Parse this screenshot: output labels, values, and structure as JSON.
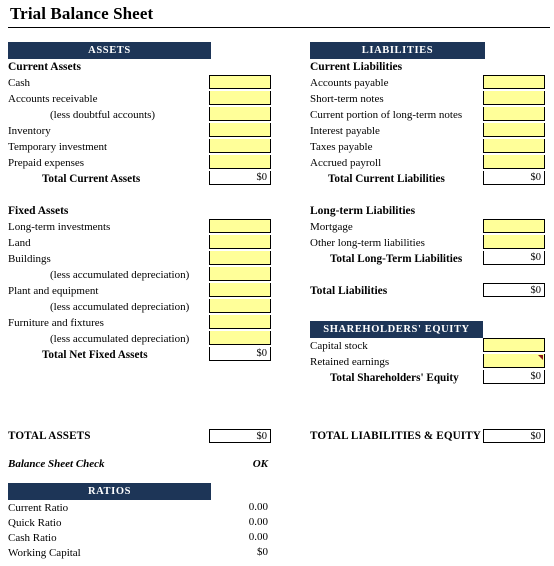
{
  "document": {
    "title": "Trial Balance Sheet"
  },
  "colors": {
    "header_bar": "#1d3557",
    "input_cell": "#ffff99",
    "output_cell": "#ffffff",
    "comment_marker": "#8b1a1a",
    "text": "#000000"
  },
  "assets": {
    "section_header": "ASSETS",
    "current": {
      "group_label": "Current Assets",
      "items": [
        {
          "label": "Cash",
          "value": ""
        },
        {
          "label": "Accounts receivable",
          "value": ""
        },
        {
          "label": "(less doubtful accounts)",
          "value": ""
        },
        {
          "label": "Inventory",
          "value": ""
        },
        {
          "label": "Temporary investment",
          "value": ""
        },
        {
          "label": "Prepaid expenses",
          "value": ""
        }
      ],
      "total_label": "Total Current Assets",
      "total_value": "$0"
    },
    "fixed": {
      "group_label": "Fixed Assets",
      "items": [
        {
          "label": "Long-term investments",
          "value": ""
        },
        {
          "label": "Land",
          "value": ""
        },
        {
          "label": "Buildings",
          "value": ""
        },
        {
          "label": "(less accumulated depreciation)",
          "value": ""
        },
        {
          "label": "Plant and equipment",
          "value": ""
        },
        {
          "label": "(less accumulated depreciation)",
          "value": ""
        },
        {
          "label": "Furniture and fixtures",
          "value": ""
        },
        {
          "label": "(less accumulated depreciation)",
          "value": ""
        }
      ],
      "total_label": "Total Net Fixed Assets",
      "total_value": "$0"
    },
    "grand_total_label": "TOTAL ASSETS",
    "grand_total_value": "$0"
  },
  "balance_check": {
    "label": "Balance Sheet Check",
    "value": "OK"
  },
  "liabilities": {
    "section_header": "LIABILITIES",
    "current": {
      "group_label": "Current Liabilities",
      "items": [
        {
          "label": "Accounts payable",
          "value": ""
        },
        {
          "label": "Short-term notes",
          "value": ""
        },
        {
          "label": "Current portion of long-term notes",
          "value": ""
        },
        {
          "label": "Interest payable",
          "value": ""
        },
        {
          "label": "Taxes payable",
          "value": ""
        },
        {
          "label": "Accrued payroll",
          "value": ""
        }
      ],
      "total_label": "Total Current Liabilities",
      "total_value": "$0"
    },
    "long_term": {
      "group_label": "Long-term Liabilities",
      "items": [
        {
          "label": "Mortgage",
          "value": ""
        },
        {
          "label": "Other long-term liabilities",
          "value": ""
        }
      ],
      "total_label": "Total Long-Term Liabilities",
      "total_value": "$0"
    },
    "total_label": "Total Liabilities",
    "total_value": "$0"
  },
  "equity": {
    "section_header": "SHAREHOLDERS' EQUITY",
    "items": [
      {
        "label": "Capital stock",
        "value": "",
        "has_comment": false
      },
      {
        "label": "Retained earnings",
        "value": "",
        "has_comment": true
      }
    ],
    "total_label": "Total Shareholders' Equity",
    "total_value": "$0"
  },
  "grand_total": {
    "label": "TOTAL LIABILITIES & EQUITY",
    "value": "$0"
  },
  "ratios": {
    "section_header": "RATIOS",
    "items": [
      {
        "label": "Current Ratio",
        "value": "0.00"
      },
      {
        "label": "Quick Ratio",
        "value": "0.00"
      },
      {
        "label": "Cash Ratio",
        "value": "0.00"
      },
      {
        "label": "Working Capital",
        "value": "$0"
      }
    ]
  }
}
